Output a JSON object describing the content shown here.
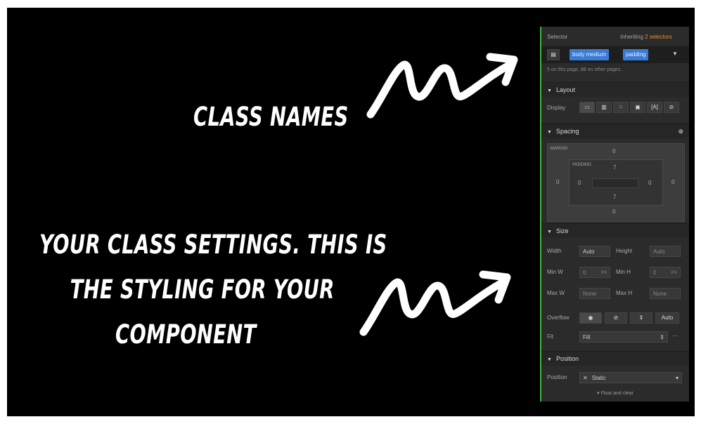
{
  "captions": {
    "class_names": "CLASS NAMES",
    "class_settings": [
      "YOUR CLASS SETTINGS. THIS IS",
      "THE STYLING FOR YOUR",
      "COMPONENT"
    ]
  },
  "panel": {
    "selector_label": "Selector",
    "inheriting_prefix": "Inheriting",
    "inheriting_count": "2 selectors",
    "classes": [
      "body medium",
      "padding"
    ],
    "usage_note": "5 on this page, 88 on other pages.",
    "layout": {
      "title": "Layout",
      "display_label": "Display",
      "display_options": [
        "block-icon",
        "flex-icon",
        "grid-icon",
        "inline-block-icon",
        "inline-icon",
        "none-icon"
      ]
    },
    "spacing": {
      "title": "Spacing",
      "margin_label": "MARGIN",
      "padding_label": "PADDING",
      "margin": {
        "top": "0",
        "right": "0",
        "bottom": "0",
        "left": "0"
      },
      "padding": {
        "top": "7",
        "right": "0",
        "bottom": "7",
        "left": "0"
      }
    },
    "size": {
      "title": "Size",
      "width_label": "Width",
      "width_value": "Auto",
      "height_label": "Height",
      "height_value": "Auto",
      "min_w_label": "Min W",
      "min_w_value": "0",
      "min_w_unit": "PX",
      "min_h_label": "Min H",
      "min_h_value": "0",
      "min_h_unit": "PX",
      "max_w_label": "Max W",
      "max_w_value": "None",
      "max_h_label": "Max H",
      "max_h_value": "None",
      "overflow_label": "Overflow",
      "overflow_auto": "Auto",
      "fit_label": "Fit",
      "fit_value": "Fill"
    },
    "position": {
      "title": "Position",
      "position_label": "Position",
      "position_value": "Static",
      "float_clear": "Float and clear"
    }
  },
  "colors": {
    "accent_orange": "#e8922f",
    "accent_blue": "#3a7bd5",
    "panel_bg": "#2b2b2b",
    "stage_bg": "#000000"
  }
}
